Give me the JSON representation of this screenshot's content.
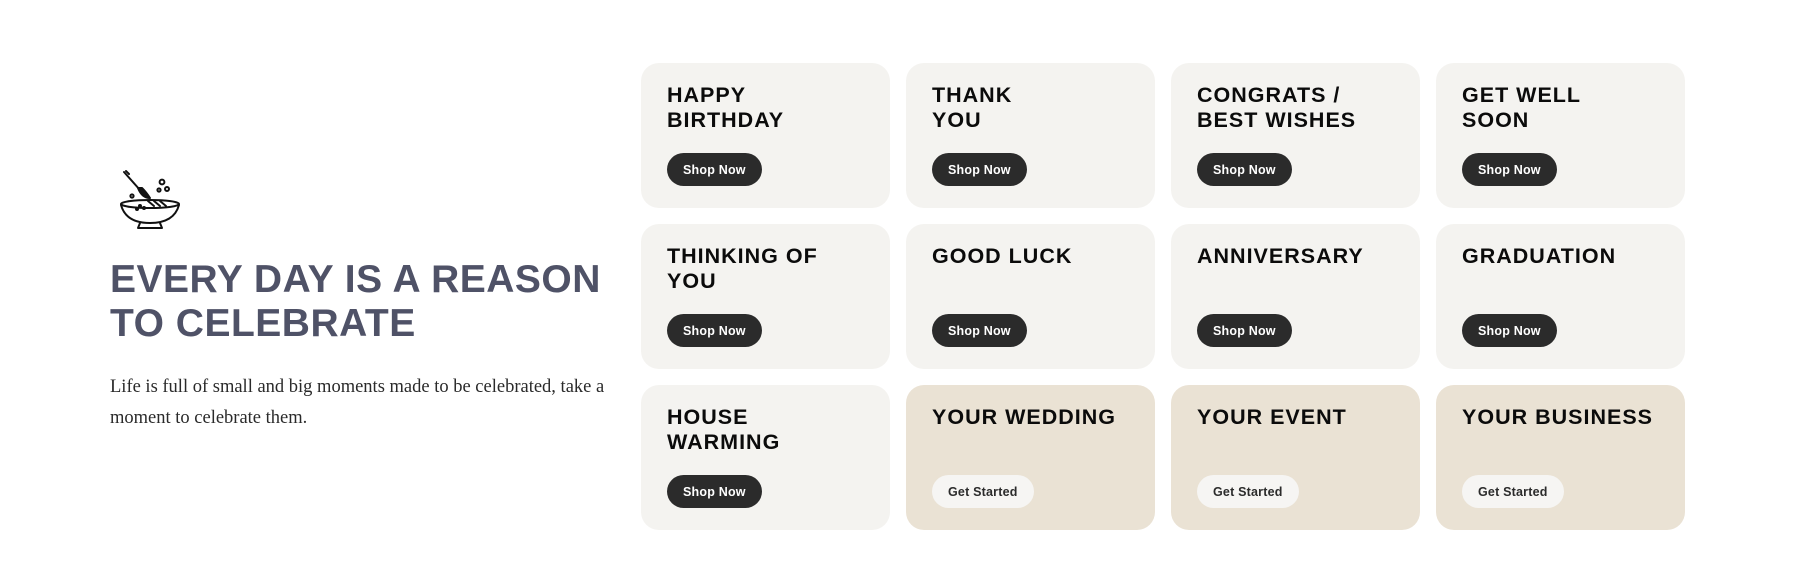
{
  "hero": {
    "icon": "mixing-bowl-whisk-icon",
    "title": "EVERY DAY IS A REASON TO CELEBRATE",
    "subtitle": "Life is full of small and big moments made to be celebrated, take a moment to celebrate them."
  },
  "cards": [
    {
      "title": "HAPPY\nBIRTHDAY",
      "button": "Shop Now",
      "style": "dark"
    },
    {
      "title": "THANK\nYOU",
      "button": "Shop Now",
      "style": "dark"
    },
    {
      "title": "CONGRATS /\nBEST WISHES",
      "button": "Shop Now",
      "style": "dark"
    },
    {
      "title": "GET WELL\nSOON",
      "button": "Shop Now",
      "style": "dark"
    },
    {
      "title": "THINKING OF\nYOU",
      "button": "Shop Now",
      "style": "dark"
    },
    {
      "title": "GOOD LUCK",
      "button": "Shop Now",
      "style": "dark"
    },
    {
      "title": "ANNIVERSARY",
      "button": "Shop Now",
      "style": "dark"
    },
    {
      "title": "GRADUATION",
      "button": "Shop Now",
      "style": "dark"
    },
    {
      "title": "HOUSE\nWARMING",
      "button": "Shop Now",
      "style": "dark"
    },
    {
      "title": "YOUR WEDDING",
      "button": "Get Started",
      "style": "light"
    },
    {
      "title": "YOUR EVENT",
      "button": "Get Started",
      "style": "light"
    },
    {
      "title": "YOUR BUSINESS",
      "button": "Get Started",
      "style": "light"
    }
  ],
  "colors": {
    "headline": "#4f5267",
    "card_light": "#f4f3f0",
    "card_tan": "#eae2d4",
    "button_dark": "#2b2b2b",
    "button_light": "#f6f5f3"
  }
}
